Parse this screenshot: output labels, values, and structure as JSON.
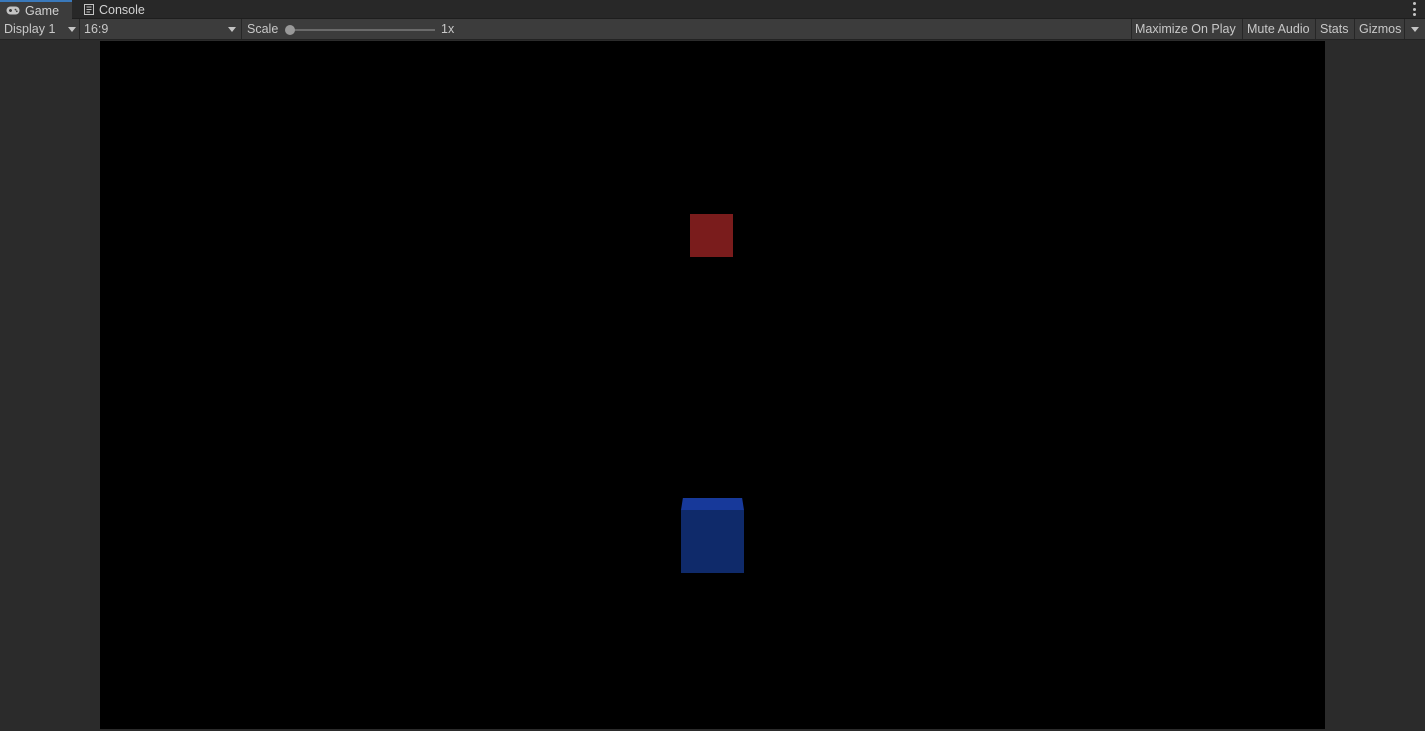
{
  "tabs": [
    {
      "label": "Game",
      "icon": "gamepad-icon",
      "active": true
    },
    {
      "label": "Console",
      "icon": "console-icon",
      "active": false
    }
  ],
  "toolbar": {
    "display": "Display 1",
    "aspect": "16:9",
    "scale_label": "Scale",
    "scale_value": "1x",
    "scale_fraction": 0.0,
    "maximize_on_play": "Maximize On Play",
    "mute_audio": "Mute Audio",
    "stats": "Stats",
    "gizmos": "Gizmos"
  },
  "colors": {
    "accent": "#3a79bb",
    "red_cube": "#7a1c1c",
    "blue_cube_top": "#17399a",
    "blue_cube_front": "#0f2a6a",
    "game_background": "#000000"
  }
}
